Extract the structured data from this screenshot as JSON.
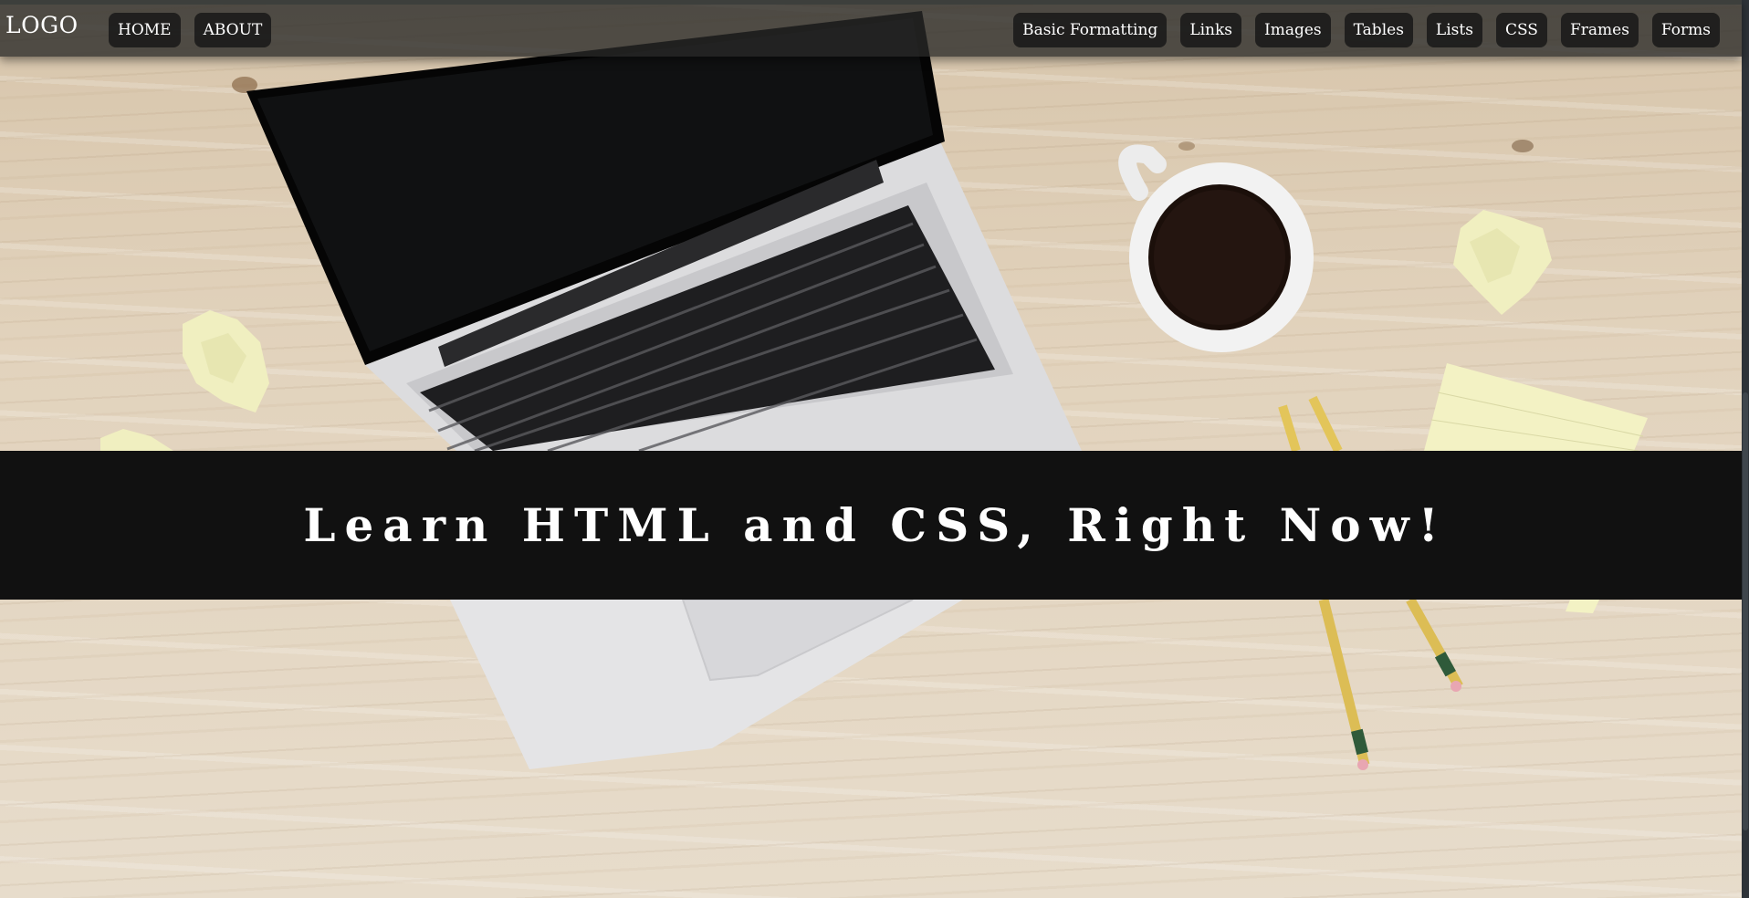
{
  "header": {
    "logo": "LOGO",
    "nav_left": [
      {
        "label": "HOME"
      },
      {
        "label": "ABOUT"
      }
    ],
    "nav_right": [
      {
        "label": "Basic Formatting"
      },
      {
        "label": "Links"
      },
      {
        "label": "Images"
      },
      {
        "label": "Tables"
      },
      {
        "label": "Lists"
      },
      {
        "label": "CSS"
      },
      {
        "label": "Frames"
      },
      {
        "label": "Forms"
      }
    ]
  },
  "banner": {
    "title": "Learn HTML and CSS, Right Now!"
  },
  "colors": {
    "navbar_bg": "#282826",
    "button_bg": "#161616",
    "banner_bg": "#111111",
    "text": "#ffffff"
  },
  "icons": {
    "hero_image": "desk-laptop-coffee-photo"
  }
}
